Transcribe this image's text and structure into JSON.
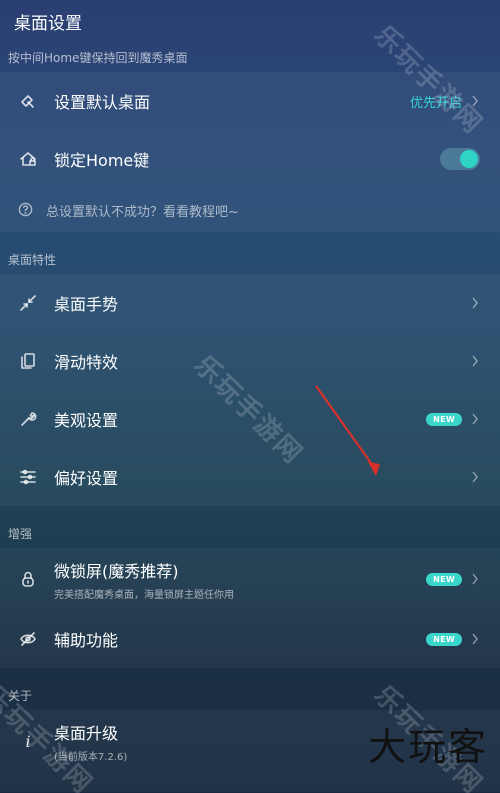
{
  "header": {
    "title": "桌面设置"
  },
  "sections": {
    "default_desktop": {
      "header": "按中间Home键保持回到魔秀桌面",
      "set_default": {
        "label": "设置默认桌面",
        "value": "优先开启"
      },
      "lock_home": {
        "label": "锁定Home键",
        "toggle_on": true
      },
      "hint": "总设置默认不成功？看看教程吧~"
    },
    "features": {
      "header": "桌面特性",
      "items": [
        {
          "label": "桌面手势",
          "icon": "gesture-arrows-icon"
        },
        {
          "label": "滑动特效",
          "icon": "copy-pages-icon"
        },
        {
          "label": "美观设置",
          "icon": "wrench-icon",
          "badge": "NEW"
        },
        {
          "label": "偏好设置",
          "icon": "sliders-icon"
        }
      ]
    },
    "enhance": {
      "header": "增强",
      "lockscreen": {
        "label": "微锁屏(魔秀推荐)",
        "sub": "完美搭配魔秀桌面，海量锁屏主题任你用",
        "badge": "NEW"
      },
      "accessibility": {
        "label": "辅助功能",
        "badge": "NEW"
      }
    },
    "about": {
      "header": "关于",
      "upgrade": {
        "label": "桌面升级",
        "sub": "(当前版本7.2.6)"
      }
    }
  },
  "watermarks": {
    "site": "乐玩手游网",
    "brand": "大玩客"
  },
  "colors": {
    "accent": "#34d3d6",
    "badge": "#3ad6cc",
    "annotation_arrow": "#d9302b"
  }
}
